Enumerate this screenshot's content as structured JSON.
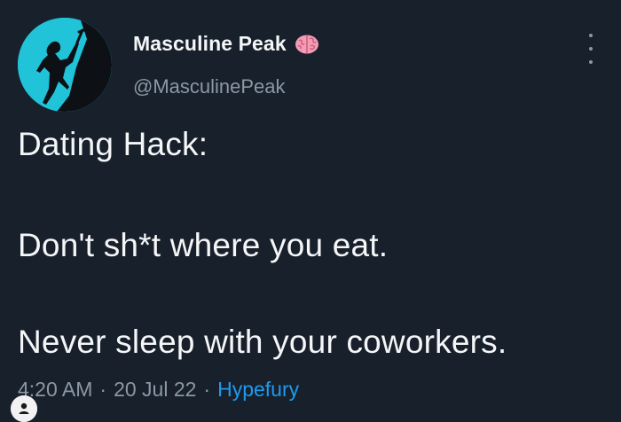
{
  "user": {
    "display_name": "Masculine Peak",
    "handle": "@MasculinePeak"
  },
  "tweet": {
    "line1": "Dating Hack:",
    "line2": "Don't sh*t where you eat.",
    "line3": "Never sleep with your coworkers."
  },
  "meta": {
    "time": "4:20 AM",
    "separator": "·",
    "date": "20 Jul 22",
    "source": "Hypefury"
  },
  "icons": {
    "avatar": "climber-silhouette",
    "badge": "brain-icon",
    "menu": "more-options-icon",
    "profile": "profile-icon"
  },
  "colors": {
    "background": "#17202b",
    "text": "#f4f6f8",
    "muted": "#8b98a5",
    "link": "#1d9bf0",
    "avatar_bg": "#21c3d8"
  }
}
